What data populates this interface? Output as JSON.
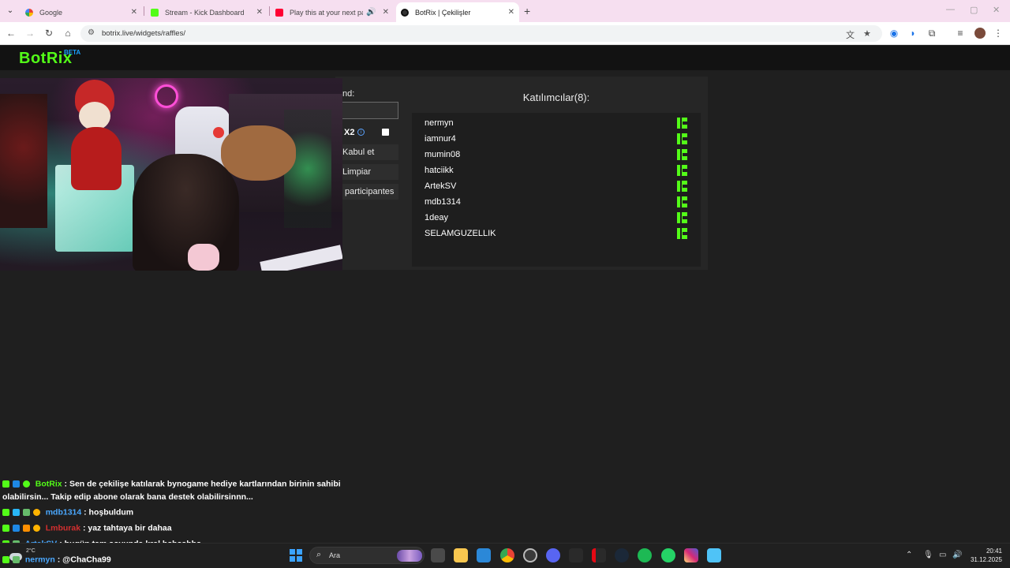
{
  "browser": {
    "tabs": [
      {
        "title": "Google",
        "icon": "google-icon"
      },
      {
        "title": "Stream - Kick Dashboard",
        "icon": "kick-icon"
      },
      {
        "title": "Play this at your next party",
        "icon": "youtube-icon"
      },
      {
        "title": "BotRix | Çekilişler",
        "icon": "botrix-icon",
        "active": true
      }
    ],
    "url": "botrix.live/widgets/raffles/"
  },
  "site": {
    "logo": "BotRix",
    "logo_badge": "BETA"
  },
  "raffle": {
    "command_label": "nd:",
    "command_value": "",
    "x2_label": "X2",
    "x2_checked": false,
    "accept_button": "Kabul et",
    "clear_button": "Limpiar",
    "participants_button": "participantes",
    "participants_title": "Katılımcılar(8):",
    "participants": [
      {
        "name": "nermyn",
        "platform": "kick"
      },
      {
        "name": "iamnur4",
        "platform": "kick"
      },
      {
        "name": "mumin08",
        "platform": "kick"
      },
      {
        "name": "hatciikk",
        "platform": "kick"
      },
      {
        "name": "ArtekSV",
        "platform": "kick"
      },
      {
        "name": "mdb1314",
        "platform": "kick"
      },
      {
        "name": "1deay",
        "platform": "kick"
      },
      {
        "name": "SELAMGUZELLIK",
        "platform": "kick"
      }
    ]
  },
  "chat": {
    "messages": [
      {
        "user": "BotRix",
        "user_color": "#53fc18",
        "text": ": Sen de çekilişe katılarak bynogame hediye kartlarından birinin sahibi",
        "continuation": "olabilirsin... Takip edip abone olarak bana destek olabilirsinnn..."
      },
      {
        "user": "mdb1314",
        "user_color": "#4aa8ff",
        "text": ": hoşbuldum"
      },
      {
        "user": "Lmburak",
        "user_color": "#d32f2f",
        "text": ": yaz tahtaya bir dahaa"
      },
      {
        "user": "ArtekSV",
        "user_color": "#4aa8ff",
        "text": ": bugün tam şovunda kral hshsshhs"
      },
      {
        "user": "nermyn",
        "user_color": "#4aa8ff",
        "text": ": @ChaCha99"
      }
    ]
  },
  "taskbar": {
    "weather_temp": "2°C",
    "search_placeholder": "Ara",
    "time": "20:41",
    "date": "31.12.2025"
  },
  "colors": {
    "kick_green": "#53fc18",
    "botrix_blue": "#19a0ff",
    "background": "#1f1f1f"
  }
}
